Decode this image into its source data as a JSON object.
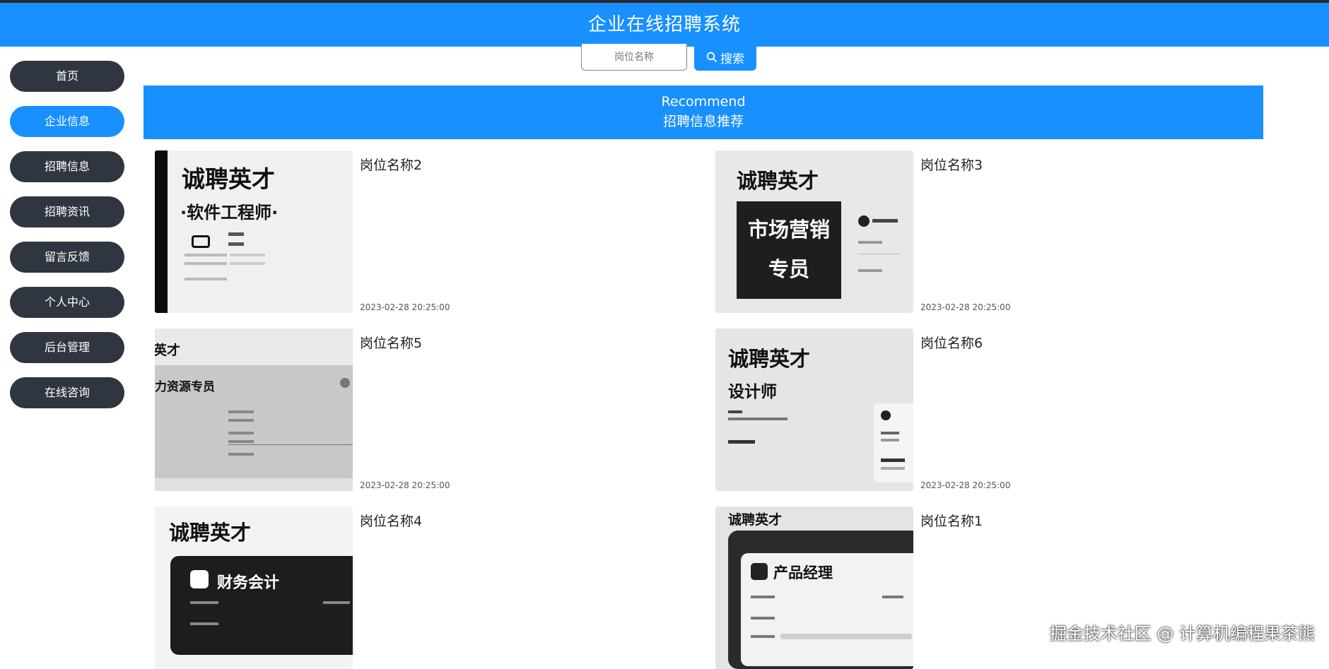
{
  "header": {
    "title": "企业在线招聘系统"
  },
  "sidebar": {
    "items": [
      {
        "label": "首页"
      },
      {
        "label": "企业信息"
      },
      {
        "label": "招聘信息"
      },
      {
        "label": "招聘资讯"
      },
      {
        "label": "留言反馈"
      },
      {
        "label": "个人中心"
      },
      {
        "label": "后台管理"
      },
      {
        "label": "在线咨询"
      }
    ],
    "active_index": 1
  },
  "search": {
    "placeholder": "岗位名称",
    "button_label": "搜索"
  },
  "banner": {
    "en": "Recommend",
    "cn": "招聘信息推荐"
  },
  "jobs": [
    {
      "title": "岗位名称2",
      "time": "2023-02-28 20:25:00",
      "poster_head": "诚聘英才",
      "poster_role": "·软件工程师·"
    },
    {
      "title": "岗位名称3",
      "time": "2023-02-28 20:25:00",
      "poster_head": "诚聘英才",
      "poster_role": "市场营销专员"
    },
    {
      "title": "岗位名称5",
      "time": "2023-02-28 20:25:00",
      "poster_head": "英才",
      "poster_role": "力资源专员"
    },
    {
      "title": "岗位名称6",
      "time": "2023-02-28 20:25:00",
      "poster_head": "诚聘英才",
      "poster_role": "设计师"
    },
    {
      "title": "岗位名称4",
      "time": "",
      "poster_head": "诚聘英才",
      "poster_role": "财务会计"
    },
    {
      "title": "岗位名称1",
      "time": "",
      "poster_head": "诚聘英才",
      "poster_role": "产品经理"
    }
  ],
  "watermark": "掘金技术社区 @ 计算机编程果茶熊",
  "colors": {
    "accent": "#1890ff",
    "nav_dark": "#303640"
  }
}
